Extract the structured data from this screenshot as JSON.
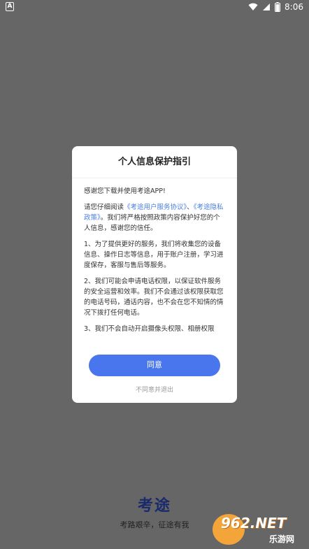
{
  "status_bar": {
    "left_icon_label": "A",
    "time": "8:06"
  },
  "dialog": {
    "title": "个人信息保护指引",
    "greeting": "感谢您下载并使用考途APP!",
    "para1_prefix": "请您仔细阅读",
    "link_user_agreement": "《考途用户服务协议》",
    "para1_sep": "、",
    "link_privacy_policy": "《考途隐私政策》",
    "para1_suffix": "。我们将严格按照政策内容保护好您的个人信息，感谢您的信任。",
    "para2": "1、为了提供更好的服务，我们将收集您的设备信息、操作日志等信息，用于账户注册，学习进度保存，客服与售后等服务。",
    "para3": "2、我们可能会申请电话权限，以保证软件服务的安全运营和效率。我们不会通过该权限获取您的电话号码，通话内容，也不会在您不知情的情况下拨打任何电话。",
    "para4": "3、我们不会自动开启摄像头权限、相册权限",
    "agree_label": "同意",
    "decline_label": "不同意并退出"
  },
  "app": {
    "logo_text": "考途",
    "slogan": "考路艰辛，征途有我"
  },
  "watermark": {
    "brand": "962.NET",
    "sub": "乐游网"
  },
  "colors": {
    "overlay": "#666666",
    "accent": "#4a76ed",
    "link": "#4a7fe0"
  }
}
